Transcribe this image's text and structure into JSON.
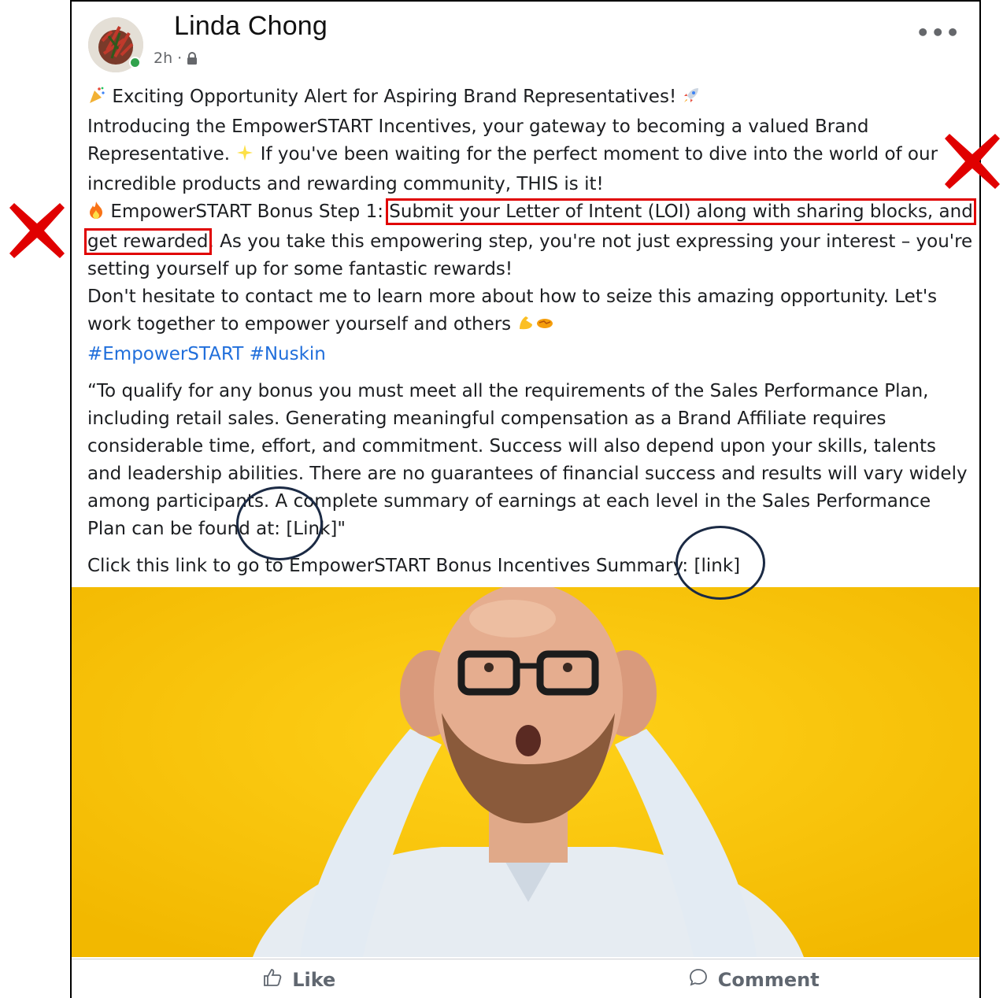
{
  "post": {
    "author": "Linda Chong",
    "time": "2h ·",
    "more_label": "•••",
    "headline": "Exciting Opportunity Alert for Aspiring Brand Representatives!",
    "intro_1": "Introducing the EmpowerSTART Incentives, your gateway to becoming a valued Brand Representative.",
    "intro_2": "If you've been waiting for the perfect moment to dive into the world of our incredible products and rewarding community, THIS is it!",
    "step_prefix": "EmpowerSTART Bonus Step 1:",
    "step_highlight": "Submit your Letter of Intent (LOI) along with sharing blocks, and get rewarded",
    "step_rest": ". As you take this empowering step, you're not just expressing your interest – you're setting yourself up for some fantastic rewards!",
    "contact": "Don't hesitate to contact me to learn more about how to seize this amazing opportunity. Let's work together to empower yourself and others",
    "hashtags": "#EmpowerSTART #Nuskin",
    "disclaimer": "“To qualify for any bonus you must meet all the requirements of the Sales Performance Plan, including retail sales. Generating meaningful compensation as a Brand Affiliate requires considerable time, effort, and commitment. Success will also depend upon your skills, talents and leadership abilities. There are no guarantees of financial success and results will vary widely among participants. A complete summary of earnings at each level in the Sales Performance Plan can be found at: [Link]\"",
    "click_line": "Click this link to go to EmpowerSTART Bonus Incentives Summary: [link]"
  },
  "actions": {
    "like": "Like",
    "comment": "Comment"
  },
  "colors": {
    "hashtag": "#216fdb",
    "annotation_red": "#e00000",
    "annotation_circle": "#1b2a44",
    "photo_background": "#f6c300"
  },
  "icons": [
    "avatar",
    "lock-icon",
    "more-icon",
    "party-popper-icon",
    "rocket-icon",
    "sparkle-icon",
    "fire-icon",
    "flexed-biceps-icon",
    "handshake-icon",
    "like-icon",
    "comment-icon"
  ]
}
